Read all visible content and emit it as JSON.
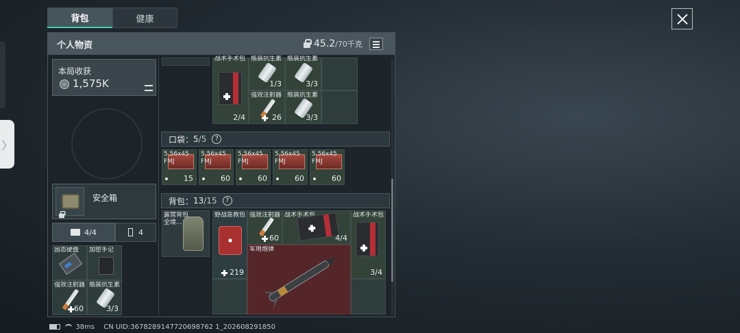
{
  "tabs": [
    "背包",
    "健康"
  ],
  "panel": {
    "title": "个人物资",
    "weight": "45.2",
    "weight_max": "/70千克"
  },
  "income": {
    "label": "本局收获",
    "value": "1,575K"
  },
  "safe_box": {
    "label": "安全箱"
  },
  "sub_tabs": [
    "4/4",
    "4"
  ],
  "safe_items": [
    {
      "name": "固态硬盘",
      "count": ""
    },
    {
      "name": "加密手记",
      "count": ""
    },
    {
      "name": "强效注射器",
      "count": "60"
    },
    {
      "name": "瓶装抗生素",
      "count": "3/3"
    }
  ],
  "top_partial": {
    "names": [
      "战术手术包",
      "瓶装抗生素",
      "瓶装抗生素"
    ]
  },
  "top_items": [
    {
      "name": "",
      "count": "2/4"
    },
    {
      "name": "",
      "count": "1/3"
    },
    {
      "name": "",
      "count": "3/3"
    },
    {
      "name": "强效注射器",
      "count": "26"
    },
    {
      "name": "瓶装抗生素",
      "count": "3/3"
    }
  ],
  "pocket": {
    "label": "口袋：",
    "count": "5",
    "max": "/5",
    "help": "?"
  },
  "pocket_items": [
    {
      "name": "5.56x45 FMJ",
      "count": "15"
    },
    {
      "name": "5.56x45 FMJ",
      "count": "60"
    },
    {
      "name": "5.56x45 FMJ",
      "count": "60"
    },
    {
      "name": "5.56x45 FMJ",
      "count": "60"
    },
    {
      "name": "5.56x45 FMJ",
      "count": "60"
    }
  ],
  "backpack": {
    "label": "背包：",
    "count": "13",
    "max": "/15",
    "help": "?"
  },
  "backpack_items": {
    "pack": {
      "name": "露营背包 全境...",
      "count": ""
    },
    "firstaid": {
      "name": "野战急救包",
      "count": "219"
    },
    "injector": {
      "name": "强效注射器",
      "count": "60"
    },
    "surgery1": {
      "name": "战术手术包",
      "count": "4/4"
    },
    "surgery2": {
      "name": "战术手术包",
      "count": "3/4"
    },
    "missile": {
      "name": "军用炮弹",
      "count": ""
    }
  },
  "status": {
    "ping": "38ms",
    "uid": "CN UID:3678289147720698762 1_202608291850"
  },
  "colors": {
    "accent": "#4ad0b0",
    "rare_red": "#54262a",
    "green": "#334339"
  }
}
